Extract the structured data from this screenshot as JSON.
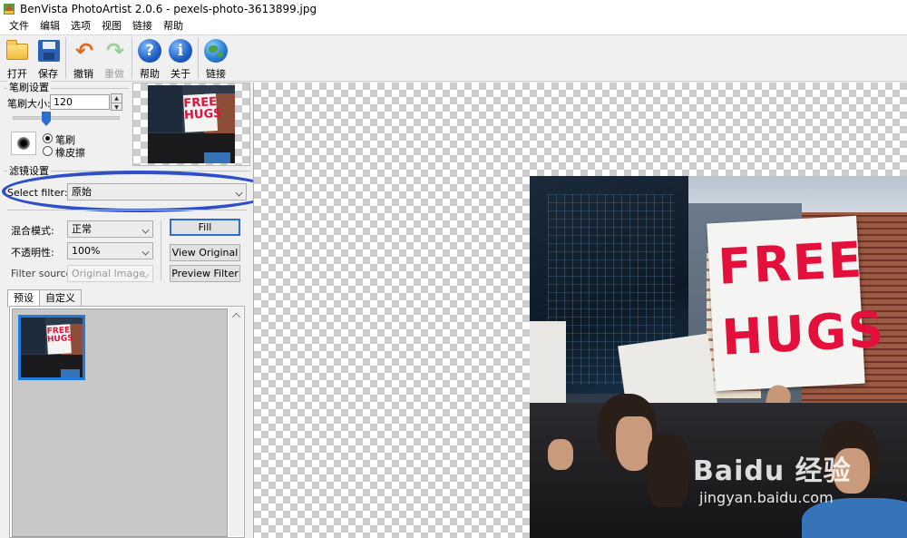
{
  "window": {
    "title": "BenVista PhotoArtist 2.0.6 - pexels-photo-3613899.jpg"
  },
  "menu": [
    "文件",
    "编辑",
    "选项",
    "视图",
    "链接",
    "帮助"
  ],
  "toolbar": {
    "open": "打开",
    "save": "保存",
    "undo": "撤销",
    "redo": "重做",
    "help": "帮助",
    "about": "关于",
    "link": "链接"
  },
  "brush": {
    "group_title": "笔刷设置",
    "size_label": "笔刷大小:",
    "size_value": "120",
    "mode_brush": "笔刷",
    "mode_eraser": "橡皮擦",
    "selected_mode": "笔刷"
  },
  "filter": {
    "group_title": "滤镜设置",
    "select_label": "Select filter:",
    "selected_filter": "原始",
    "blend_label": "混合模式:",
    "blend_value": "正常",
    "opacity_label": "不透明性:",
    "opacity_value": "100%",
    "source_label": "Filter source:",
    "source_value": "Original Image",
    "fill_button": "Fill",
    "view_original_button": "View Original",
    "preview_filter_button": "Preview Filter"
  },
  "tabs": {
    "preset": "预设",
    "custom": "自定义",
    "active": "预设"
  },
  "photo": {
    "sign_line1": "FREE",
    "sign_line2": "HUGS",
    "watermark": "Baidu 经验",
    "watermark_url": "jingyan.baidu.com"
  },
  "colors": {
    "accent_blue": "#2a6fcf",
    "highlight_oval": "#2d4fc9",
    "sign_red": "#e2103a"
  }
}
